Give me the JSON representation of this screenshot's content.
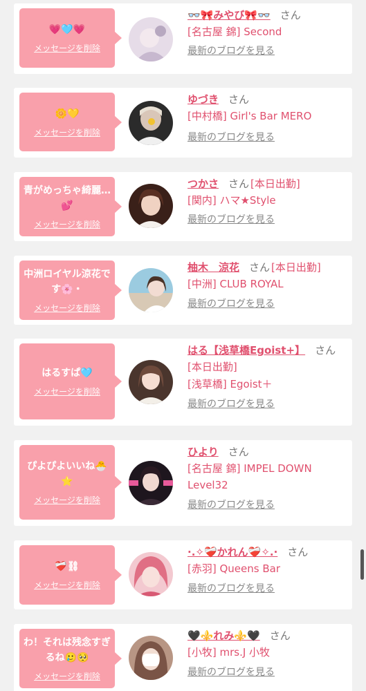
{
  "common": {
    "delete_label": "メッセージを削除",
    "blog_label": "最新のブログを見る",
    "san": "さん"
  },
  "cards": [
    {
      "message": "💗🩵💗",
      "name": "👓🎀みやび🎀👓",
      "status": "",
      "lines": [
        "[名古屋 錦] Second"
      ],
      "avatar_color": "#d9cfe0"
    },
    {
      "message": "🌼💛",
      "name": "ゆづき",
      "status": "",
      "lines": [
        "[中村橋] Girl's Bar MERO"
      ],
      "avatar_color": "#3b3b3b"
    },
    {
      "message": "青がめっちゃ綺麗…💕",
      "name": "つかさ",
      "status": "[本日出勤]",
      "lines": [
        "[関内] ハマ★Style"
      ],
      "avatar_color": "#5a3528"
    },
    {
      "message": "中洲ロイヤル涼花です🌸・",
      "name": "柚木　涼花",
      "status": "[本日出勤]",
      "lines": [
        "[中洲] CLUB ROYAL"
      ],
      "avatar_color": "#8fc2d8"
    },
    {
      "message": "はるすぱ🩵",
      "name": "はる【浅草橋Egoist+】",
      "status": "",
      "lines": [
        "[本日出勤]",
        "[浅草橋] Egoist＋"
      ],
      "avatar_color": "#6b4a3d"
    },
    {
      "message": "ぴよぴよいいね🐣⭐",
      "name": "ひより",
      "status": "",
      "lines": [
        "[名古屋 錦] IMPEL DOWN Level32"
      ],
      "avatar_color": "#2a1f2a"
    },
    {
      "message": "❤️‍🩹⛓",
      "name": "·.✧❤️‍🩹かれん❤️‍🩹✧.·",
      "status": "",
      "lines": [
        "[赤羽] Queens Bar"
      ],
      "avatar_color": "#e07a8a"
    },
    {
      "message": "わ！それは残念すぎるね🥲🥺",
      "name": "🖤⚜️れみ⚜️🖤",
      "status": "",
      "lines": [
        "[小牧] mrs.J 小牧"
      ],
      "avatar_color": "#a88a7a"
    }
  ],
  "colors": {
    "bubble": "#f9a0ab",
    "accent": "#e0506e",
    "background": "#f1f1f1"
  }
}
